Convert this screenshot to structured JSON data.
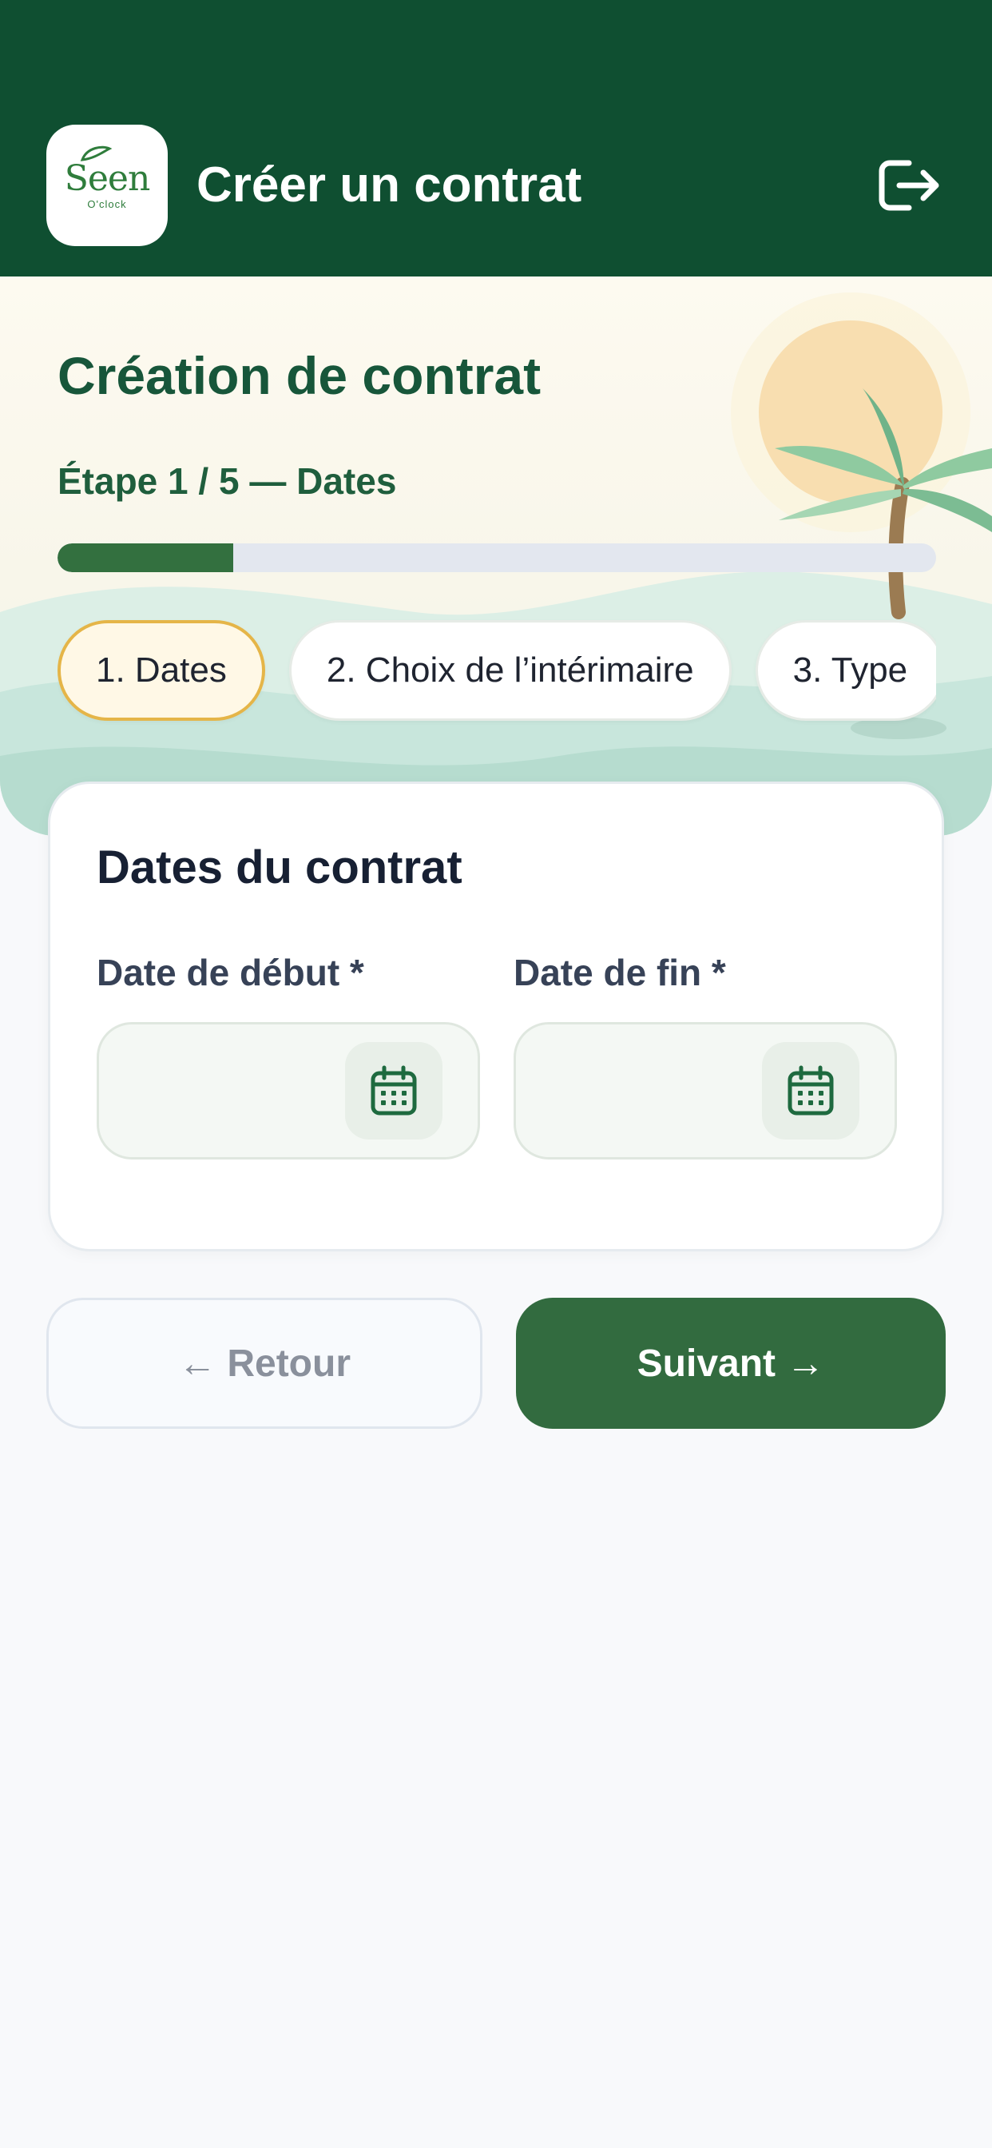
{
  "header": {
    "logo_text": "Seen",
    "logo_subtext": "O'clock",
    "title": "Créer un contrat",
    "logout_icon": "logout-icon"
  },
  "hero": {
    "title": "Création de contrat",
    "step_label": "Étape 1 / 5 — Dates",
    "progress_fraction": 0.2
  },
  "steps": [
    {
      "label": "1. Dates",
      "active": true
    },
    {
      "label": "2. Choix de l’intérimaire",
      "active": false
    },
    {
      "label": "3. Type",
      "active": false
    }
  ],
  "card": {
    "title": "Dates du contrat",
    "start_label": "Date de début *",
    "start_value": "",
    "end_label": "Date de fin *",
    "end_value": "",
    "calendar_icon": "calendar-icon"
  },
  "actions": {
    "back_label": "← Retour",
    "next_label": "Suivant →"
  },
  "colors": {
    "header_bg": "#0f4f31",
    "primary": "#326b3f",
    "active_step_border": "#e5b548",
    "active_step_bg": "#fff8e6"
  }
}
